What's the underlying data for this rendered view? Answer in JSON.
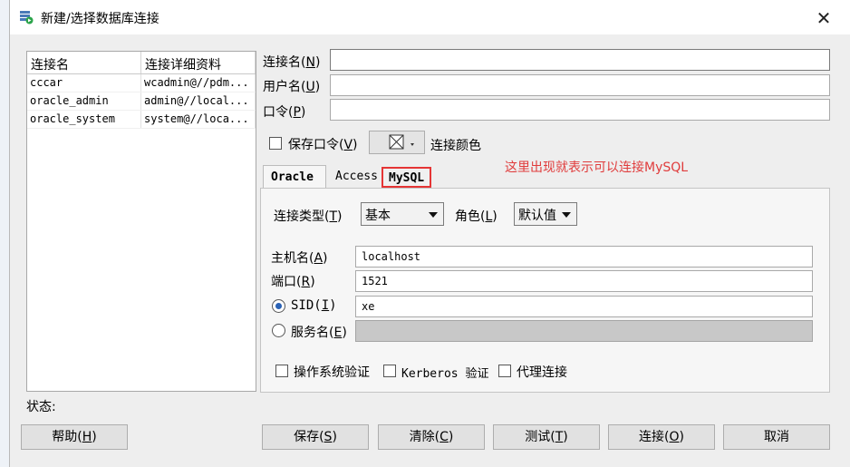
{
  "window": {
    "title": "新建/选择数据库连接"
  },
  "connections": {
    "columns": [
      "连接名",
      "连接详细资料"
    ],
    "rows": [
      [
        "cccar",
        "wcadmin@//pdm..."
      ],
      [
        "oracle_admin",
        "admin@//local..."
      ],
      [
        "oracle_system",
        "system@//loca..."
      ]
    ]
  },
  "form": {
    "conn_name_label": "连接名(",
    "conn_name_key": "N",
    "conn_name_value": "",
    "user_label": "用户名(",
    "user_key": "U",
    "user_value": "",
    "password_label": "口令(",
    "password_key": "P",
    "password_value": "",
    "save_password_label": "保存口令(",
    "save_password_key": "V",
    "save_password_checked": false,
    "conn_color_label": "连接颜色"
  },
  "tabs": [
    {
      "label": "Oracle",
      "selected": true
    },
    {
      "label": "Access",
      "selected": false
    },
    {
      "label": "MySQL",
      "selected": false,
      "highlighted": true
    }
  ],
  "annotation": "这里出现就表示可以连接MySQL",
  "oracle": {
    "conn_type_label": "连接类型(",
    "conn_type_key": "T",
    "conn_type_value": "基本",
    "role_label": "角色(",
    "role_key": "L",
    "role_value": "默认值",
    "host_label": "主机名(",
    "host_key": "A",
    "host_value": "localhost",
    "port_label": "端口(",
    "port_key": "R",
    "port_value": "1521",
    "sid_label": "SID(",
    "sid_key": "I",
    "sid_value": "xe",
    "sid_selected": true,
    "service_label": "服务名(",
    "service_key": "E",
    "service_value": "",
    "os_auth_label": "操作系统验证",
    "kerberos_label": "Kerberos 验证",
    "proxy_label": "代理连接"
  },
  "status_label": "状态:",
  "buttons": {
    "help": "帮助(",
    "help_key": "H",
    "save": "保存(",
    "save_key": "S",
    "clear": "清除(",
    "clear_key": "C",
    "test": "测试(",
    "test_key": "T",
    "connect": "连接(",
    "connect_key": "O",
    "cancel": "取消"
  },
  "colors": {
    "annotation": "#e03c3c",
    "highlight_border": "#e53535",
    "sid_radio": "#2a62b5"
  }
}
